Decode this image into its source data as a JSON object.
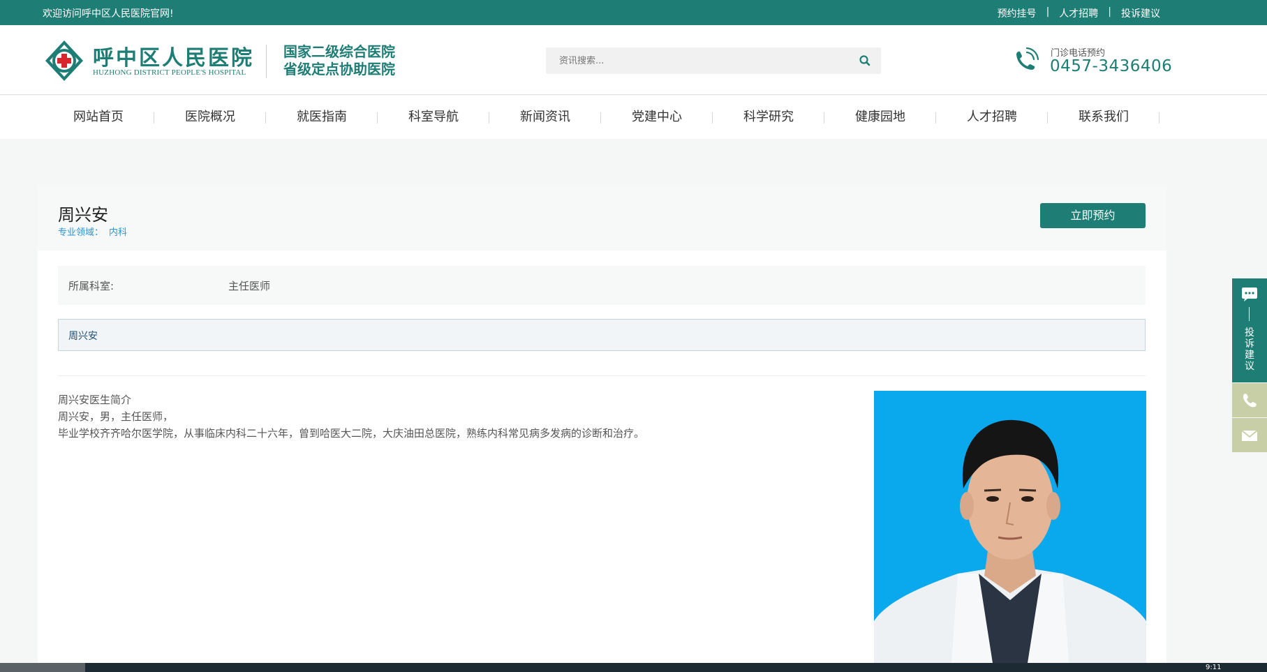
{
  "topbar": {
    "welcome": "欢迎访问呼中区人民医院官网!",
    "links": [
      "预约挂号",
      "人才招聘",
      "投诉建议"
    ],
    "separator": "|"
  },
  "header": {
    "logo_cn": "呼中区人民医院",
    "logo_en": "HUZHONG DISTRICT PEOPLE'S HOSPITAL",
    "tagline_1": "国家二级综合医院",
    "tagline_2": "省级定点协助医院",
    "search_placeholder": "资讯搜索...",
    "phone_label": "门诊电话预约",
    "phone_number": "0457-3436406"
  },
  "nav": [
    "网站首页",
    "医院概况",
    "就医指南",
    "科室导航",
    "新闻资讯",
    "党建中心",
    "科学研究",
    "健康园地",
    "人才招聘",
    "联系我们"
  ],
  "doctor": {
    "name": "周兴安",
    "specialty_label": "专业领域：",
    "specialty_value": "内科",
    "book_button": "立即预约",
    "dept_label": "所属科室:",
    "dept_value": "主任医师",
    "name_box": "周兴安",
    "intro_title": "周兴安医生简介",
    "intro_line1": "周兴安，男，主任医师，",
    "intro_line2": "毕业学校齐齐哈尔医学院，从事临床内科二十六年，曾到哈医大二院，大庆油田总医院，熟练内科常见病多发病的诊断和治疗。"
  },
  "float_bar": {
    "complaint_chars": [
      "投",
      "诉",
      "建",
      "议"
    ]
  },
  "taskbar": {
    "clock": "9:11"
  },
  "colors": {
    "brand": "#1e7d74",
    "link_blue": "#2d94d6",
    "photo_bg": "#0aa8ec",
    "float_light": "#c8cfa6"
  }
}
